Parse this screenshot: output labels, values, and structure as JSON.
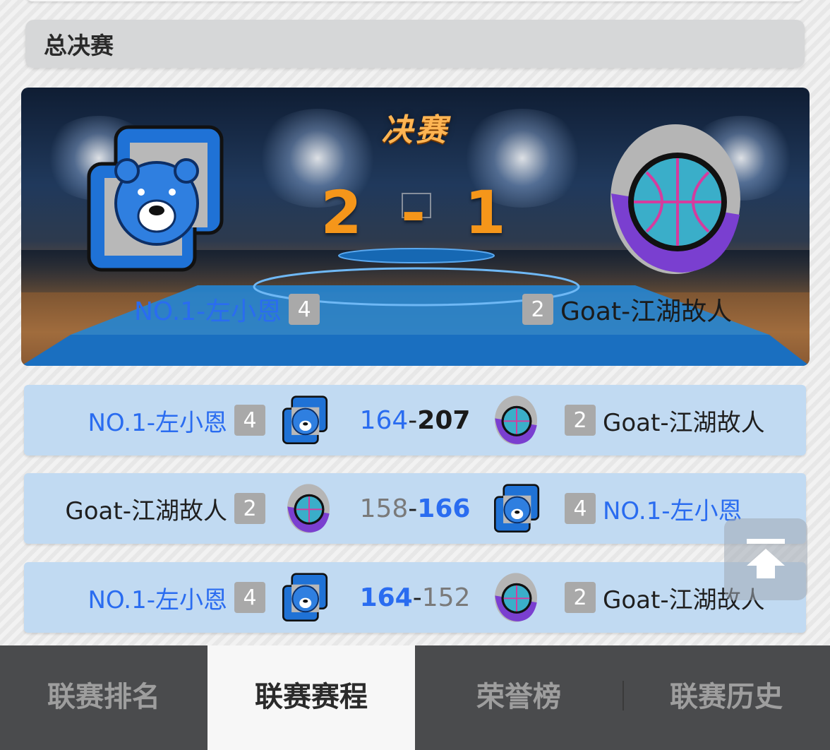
{
  "section": {
    "title": "总决赛"
  },
  "final": {
    "title": "决赛",
    "score_home": "2",
    "score_sep": "-",
    "score_away": "1",
    "team_home": {
      "name": "NO.1-左小恩",
      "seed": "4",
      "logo": "bear-shield-icon"
    },
    "team_away": {
      "name": "Goat-江湖故人",
      "seed": "2",
      "logo": "basketball-egg-icon"
    }
  },
  "matches": [
    {
      "left": {
        "name": "NO.1-左小恩",
        "seed": "4",
        "logo": "bear-shield-icon"
      },
      "score_left": "164",
      "score_right": "207",
      "right": {
        "name": "Goat-江湖故人",
        "seed": "2",
        "logo": "basketball-egg-icon"
      }
    },
    {
      "left": {
        "name": "Goat-江湖故人",
        "seed": "2",
        "logo": "basketball-egg-icon"
      },
      "score_left": "158",
      "score_right": "166",
      "right": {
        "name": "NO.1-左小恩",
        "seed": "4",
        "logo": "bear-shield-icon"
      }
    },
    {
      "left": {
        "name": "NO.1-左小恩",
        "seed": "4",
        "logo": "bear-shield-icon"
      },
      "score_left": "164",
      "score_right": "152",
      "right": {
        "name": "Goat-江湖故人",
        "seed": "2",
        "logo": "basketball-egg-icon"
      }
    }
  ],
  "tabs": [
    {
      "label": "联赛排名",
      "active": false
    },
    {
      "label": "联赛赛程",
      "active": true
    },
    {
      "label": "荣誉榜",
      "active": false
    },
    {
      "label": "联赛历史",
      "active": false
    }
  ],
  "score_dash": "-",
  "back_to_top": "arrow-up-to-top-icon"
}
